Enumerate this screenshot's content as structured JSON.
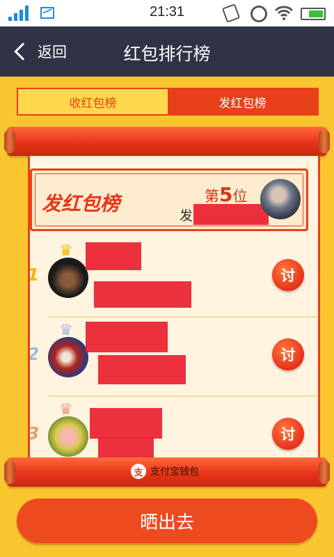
{
  "status_bar": {
    "time": "21:31"
  },
  "nav": {
    "back_label": "返回",
    "title": "红包排行榜"
  },
  "tabs": [
    {
      "label": "收红包榜",
      "active": false
    },
    {
      "label": "发红包榜",
      "active": true
    }
  ],
  "banner": {
    "title": "发红包榜",
    "rank_prefix": "第",
    "rank_number": "5",
    "rank_suffix": "位",
    "subtitle_visible": "发"
  },
  "rows": [
    {
      "rank": "1",
      "action_label": "讨",
      "crown": "gold"
    },
    {
      "rank": "2",
      "action_label": "讨",
      "crown": "silver"
    },
    {
      "rank": "3",
      "action_label": "讨",
      "crown": "bronze"
    }
  ],
  "alipay": {
    "logo_char": "支",
    "label": "支付宝钱包"
  },
  "share_button": {
    "label": "晒出去"
  },
  "colors": {
    "background": "#f9c630",
    "navbar": "#2f3345",
    "accent": "#e8401a",
    "gold": "#f7b500",
    "silver": "#a7b8d9",
    "bronze": "#e1a27c"
  }
}
